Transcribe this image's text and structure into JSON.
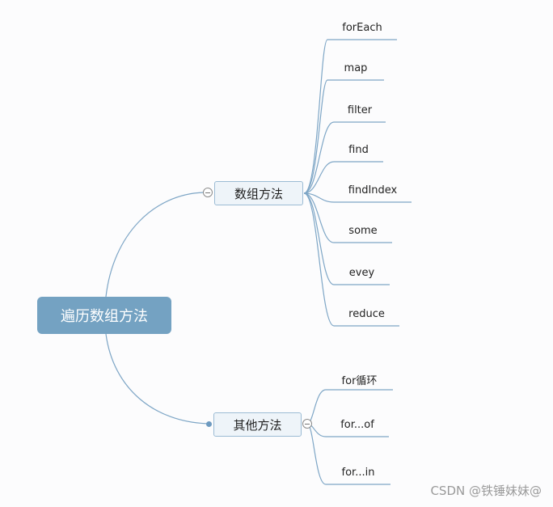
{
  "diagram": {
    "type": "mindmap",
    "root": {
      "label": "遍历数组方法"
    },
    "branches": [
      {
        "label": "数组方法",
        "collapsed": false,
        "children": [
          "forEach",
          "map",
          "filter",
          "find",
          "findIndex",
          "some",
          "evey",
          "reduce"
        ]
      },
      {
        "label": "其他方法",
        "collapsed": false,
        "children": [
          "for循环",
          "for...of",
          "for...in"
        ]
      }
    ],
    "line_color": "#7ea6c6",
    "root_color": "#74a2c2",
    "branch_fill": "#eef4f9"
  },
  "watermark": "CSDN @铁锤妹妹@"
}
